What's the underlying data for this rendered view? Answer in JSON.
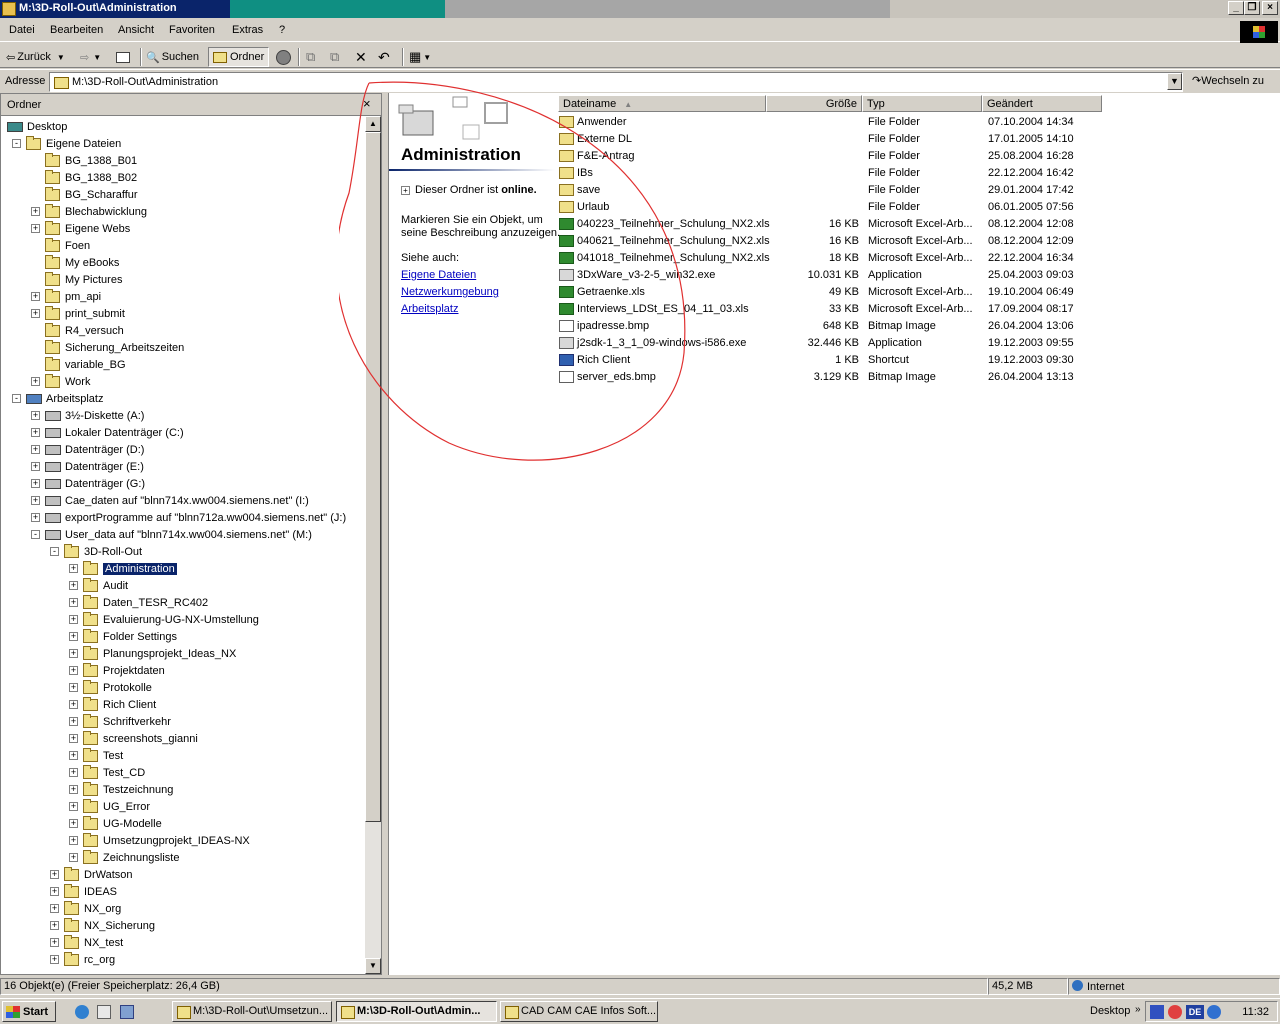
{
  "window": {
    "title": "M:\\3D-Roll-Out\\Administration"
  },
  "menu": [
    "Datei",
    "Bearbeiten",
    "Ansicht",
    "Favoriten",
    "Extras",
    "?"
  ],
  "toolbar": {
    "back": "Zurück",
    "search": "Suchen",
    "folders": "Ordner"
  },
  "address": {
    "label": "Adresse",
    "value": "M:\\3D-Roll-Out\\Administration",
    "go": "Wechseln zu"
  },
  "folder_pane": {
    "title": "Ordner",
    "close": "×",
    "tree": [
      {
        "label": "Desktop",
        "indent": 0,
        "exp": "",
        "icon": "desktop",
        "selected": false
      },
      {
        "label": "Eigene Dateien",
        "indent": 1,
        "exp": "-",
        "icon": "folder",
        "selected": false
      },
      {
        "label": "BG_1388_B01",
        "indent": 2,
        "exp": "",
        "icon": "folder",
        "selected": false
      },
      {
        "label": "BG_1388_B02",
        "indent": 2,
        "exp": "",
        "icon": "folder",
        "selected": false
      },
      {
        "label": "BG_Scharaffur",
        "indent": 2,
        "exp": "",
        "icon": "folder",
        "selected": false
      },
      {
        "label": "Blechabwicklung",
        "indent": 2,
        "exp": "+",
        "icon": "folder",
        "selected": false
      },
      {
        "label": "Eigene Webs",
        "indent": 2,
        "exp": "+",
        "icon": "folder",
        "selected": false
      },
      {
        "label": "Foen",
        "indent": 2,
        "exp": "",
        "icon": "folder",
        "selected": false
      },
      {
        "label": "My eBooks",
        "indent": 2,
        "exp": "",
        "icon": "folder",
        "selected": false
      },
      {
        "label": "My Pictures",
        "indent": 2,
        "exp": "",
        "icon": "folder",
        "selected": false
      },
      {
        "label": "pm_api",
        "indent": 2,
        "exp": "+",
        "icon": "folder",
        "selected": false
      },
      {
        "label": "print_submit",
        "indent": 2,
        "exp": "+",
        "icon": "folder",
        "selected": false
      },
      {
        "label": "R4_versuch",
        "indent": 2,
        "exp": "",
        "icon": "folder",
        "selected": false
      },
      {
        "label": "Sicherung_Arbeitszeiten",
        "indent": 2,
        "exp": "",
        "icon": "folder",
        "selected": false
      },
      {
        "label": "variable_BG",
        "indent": 2,
        "exp": "",
        "icon": "folder",
        "selected": false
      },
      {
        "label": "Work",
        "indent": 2,
        "exp": "+",
        "icon": "folder",
        "selected": false
      },
      {
        "label": "Arbeitsplatz",
        "indent": 1,
        "exp": "-",
        "icon": "computer",
        "selected": false
      },
      {
        "label": "3½-Diskette (A:)",
        "indent": 2,
        "exp": "+",
        "icon": "drive",
        "selected": false
      },
      {
        "label": "Lokaler Datenträger (C:)",
        "indent": 2,
        "exp": "+",
        "icon": "drive",
        "selected": false
      },
      {
        "label": "Datenträger (D:)",
        "indent": 2,
        "exp": "+",
        "icon": "drive",
        "selected": false
      },
      {
        "label": "Datenträger (E:)",
        "indent": 2,
        "exp": "+",
        "icon": "drive",
        "selected": false
      },
      {
        "label": "Datenträger (G:)",
        "indent": 2,
        "exp": "+",
        "icon": "drive",
        "selected": false
      },
      {
        "label": "Cae_daten auf \"blnn714x.ww004.siemens.net\" (I:)",
        "indent": 2,
        "exp": "+",
        "icon": "drive",
        "selected": false
      },
      {
        "label": "exportProgramme auf \"blnn712a.ww004.siemens.net\" (J:)",
        "indent": 2,
        "exp": "+",
        "icon": "drive",
        "selected": false
      },
      {
        "label": "User_data auf \"blnn714x.ww004.siemens.net\" (M:)",
        "indent": 2,
        "exp": "-",
        "icon": "drive",
        "selected": false
      },
      {
        "label": "3D-Roll-Out",
        "indent": 3,
        "exp": "-",
        "icon": "folder",
        "selected": false
      },
      {
        "label": "Administration",
        "indent": 4,
        "exp": "+",
        "icon": "folder",
        "selected": true
      },
      {
        "label": "Audit",
        "indent": 4,
        "exp": "+",
        "icon": "folder",
        "selected": false
      },
      {
        "label": "Daten_TESR_RC402",
        "indent": 4,
        "exp": "+",
        "icon": "folder",
        "selected": false
      },
      {
        "label": "Evaluierung-UG-NX-Umstellung",
        "indent": 4,
        "exp": "+",
        "icon": "folder",
        "selected": false
      },
      {
        "label": "Folder Settings",
        "indent": 4,
        "exp": "+",
        "icon": "folder",
        "selected": false
      },
      {
        "label": "Planungsprojekt_Ideas_NX",
        "indent": 4,
        "exp": "+",
        "icon": "folder",
        "selected": false
      },
      {
        "label": "Projektdaten",
        "indent": 4,
        "exp": "+",
        "icon": "folder",
        "selected": false
      },
      {
        "label": "Protokolle",
        "indent": 4,
        "exp": "+",
        "icon": "folder",
        "selected": false
      },
      {
        "label": "Rich Client",
        "indent": 4,
        "exp": "+",
        "icon": "folder",
        "selected": false
      },
      {
        "label": "Schriftverkehr",
        "indent": 4,
        "exp": "+",
        "icon": "folder",
        "selected": false
      },
      {
        "label": "screenshots_gianni",
        "indent": 4,
        "exp": "+",
        "icon": "folder",
        "selected": false
      },
      {
        "label": "Test",
        "indent": 4,
        "exp": "+",
        "icon": "folder",
        "selected": false
      },
      {
        "label": "Test_CD",
        "indent": 4,
        "exp": "+",
        "icon": "folder",
        "selected": false
      },
      {
        "label": "Testzeichnung",
        "indent": 4,
        "exp": "+",
        "icon": "folder",
        "selected": false
      },
      {
        "label": "UG_Error",
        "indent": 4,
        "exp": "+",
        "icon": "folder",
        "selected": false
      },
      {
        "label": "UG-Modelle",
        "indent": 4,
        "exp": "+",
        "icon": "folder",
        "selected": false
      },
      {
        "label": "Umsetzungprojekt_IDEAS-NX",
        "indent": 4,
        "exp": "+",
        "icon": "folder",
        "selected": false
      },
      {
        "label": "Zeichnungsliste",
        "indent": 4,
        "exp": "+",
        "icon": "folder",
        "selected": false
      },
      {
        "label": "DrWatson",
        "indent": 3,
        "exp": "+",
        "icon": "folder",
        "selected": false
      },
      {
        "label": "IDEAS",
        "indent": 3,
        "exp": "+",
        "icon": "folder",
        "selected": false
      },
      {
        "label": "NX_org",
        "indent": 3,
        "exp": "+",
        "icon": "folder",
        "selected": false
      },
      {
        "label": "NX_Sicherung",
        "indent": 3,
        "exp": "+",
        "icon": "folder",
        "selected": false
      },
      {
        "label": "NX_test",
        "indent": 3,
        "exp": "+",
        "icon": "folder",
        "selected": false
      },
      {
        "label": "rc_org",
        "indent": 3,
        "exp": "+",
        "icon": "folder",
        "selected": false
      }
    ]
  },
  "webview": {
    "title": "Administration",
    "online_prefix": "Dieser Ordner ist",
    "online_word": "online.",
    "info": "Markieren Sie ein Objekt, um seine Beschreibung anzuzeigen.",
    "see_also": "Siehe auch:",
    "links": [
      "Eigene Dateien",
      "Netzwerkumgebung",
      "Arbeitsplatz"
    ]
  },
  "file_list": {
    "columns": [
      "Dateiname",
      "Größe",
      "Typ",
      "Geändert"
    ],
    "rows": [
      {
        "name": "Anwender",
        "size": "",
        "type": "File Folder",
        "modified": "07.10.2004 14:34",
        "icon": "folder"
      },
      {
        "name": "Externe DL",
        "size": "",
        "type": "File Folder",
        "modified": "17.01.2005 14:10",
        "icon": "folder"
      },
      {
        "name": "F&E-Antrag",
        "size": "",
        "type": "File Folder",
        "modified": "25.08.2004 16:28",
        "icon": "folder"
      },
      {
        "name": "IBs",
        "size": "",
        "type": "File Folder",
        "modified": "22.12.2004 16:42",
        "icon": "folder"
      },
      {
        "name": "save",
        "size": "",
        "type": "File Folder",
        "modified": "29.01.2004 17:42",
        "icon": "folder"
      },
      {
        "name": "Urlaub",
        "size": "",
        "type": "File Folder",
        "modified": "06.01.2005 07:56",
        "icon": "folder"
      },
      {
        "name": "040223_Teilnehmer_Schulung_NX2.xls",
        "size": "16 KB",
        "type": "Microsoft Excel-Arb...",
        "modified": "08.12.2004 12:08",
        "icon": "xls"
      },
      {
        "name": "040621_Teilnehmer_Schulung_NX2.xls",
        "size": "16 KB",
        "type": "Microsoft Excel-Arb...",
        "modified": "08.12.2004 12:09",
        "icon": "xls"
      },
      {
        "name": "041018_Teilnehmer_Schulung_NX2.xls",
        "size": "18 KB",
        "type": "Microsoft Excel-Arb...",
        "modified": "22.12.2004 16:34",
        "icon": "xls"
      },
      {
        "name": "3DxWare_v3-2-5_win32.exe",
        "size": "10.031 KB",
        "type": "Application",
        "modified": "25.04.2003 09:03",
        "icon": "exe"
      },
      {
        "name": "Getraenke.xls",
        "size": "49 KB",
        "type": "Microsoft Excel-Arb...",
        "modified": "19.10.2004 06:49",
        "icon": "xls"
      },
      {
        "name": "Interviews_LDSt_ES_04_11_03.xls",
        "size": "33 KB",
        "type": "Microsoft Excel-Arb...",
        "modified": "17.09.2004 08:17",
        "icon": "xls"
      },
      {
        "name": "ipadresse.bmp",
        "size": "648 KB",
        "type": "Bitmap Image",
        "modified": "26.04.2004 13:06",
        "icon": "bmp"
      },
      {
        "name": "j2sdk-1_3_1_09-windows-i586.exe",
        "size": "32.446 KB",
        "type": "Application",
        "modified": "19.12.2003 09:55",
        "icon": "exe"
      },
      {
        "name": "Rich Client",
        "size": "1 KB",
        "type": "Shortcut",
        "modified": "19.12.2003 09:30",
        "icon": "lnk"
      },
      {
        "name": "server_eds.bmp",
        "size": "3.129 KB",
        "type": "Bitmap Image",
        "modified": "26.04.2004 13:13",
        "icon": "bmp"
      }
    ]
  },
  "status": {
    "objects": "16 Objekt(e) (Freier Speicherplatz: 26,4 GB)",
    "size": "45,2 MB",
    "zone": "Internet"
  },
  "taskbar": {
    "start": "Start",
    "tasks": [
      "M:\\3D-Roll-Out\\Umsetzun...",
      "M:\\3D-Roll-Out\\Admin...",
      "CAD CAM CAE Infos Soft..."
    ],
    "desktop": "Desktop",
    "lang": "DE",
    "clock": "11:32"
  }
}
